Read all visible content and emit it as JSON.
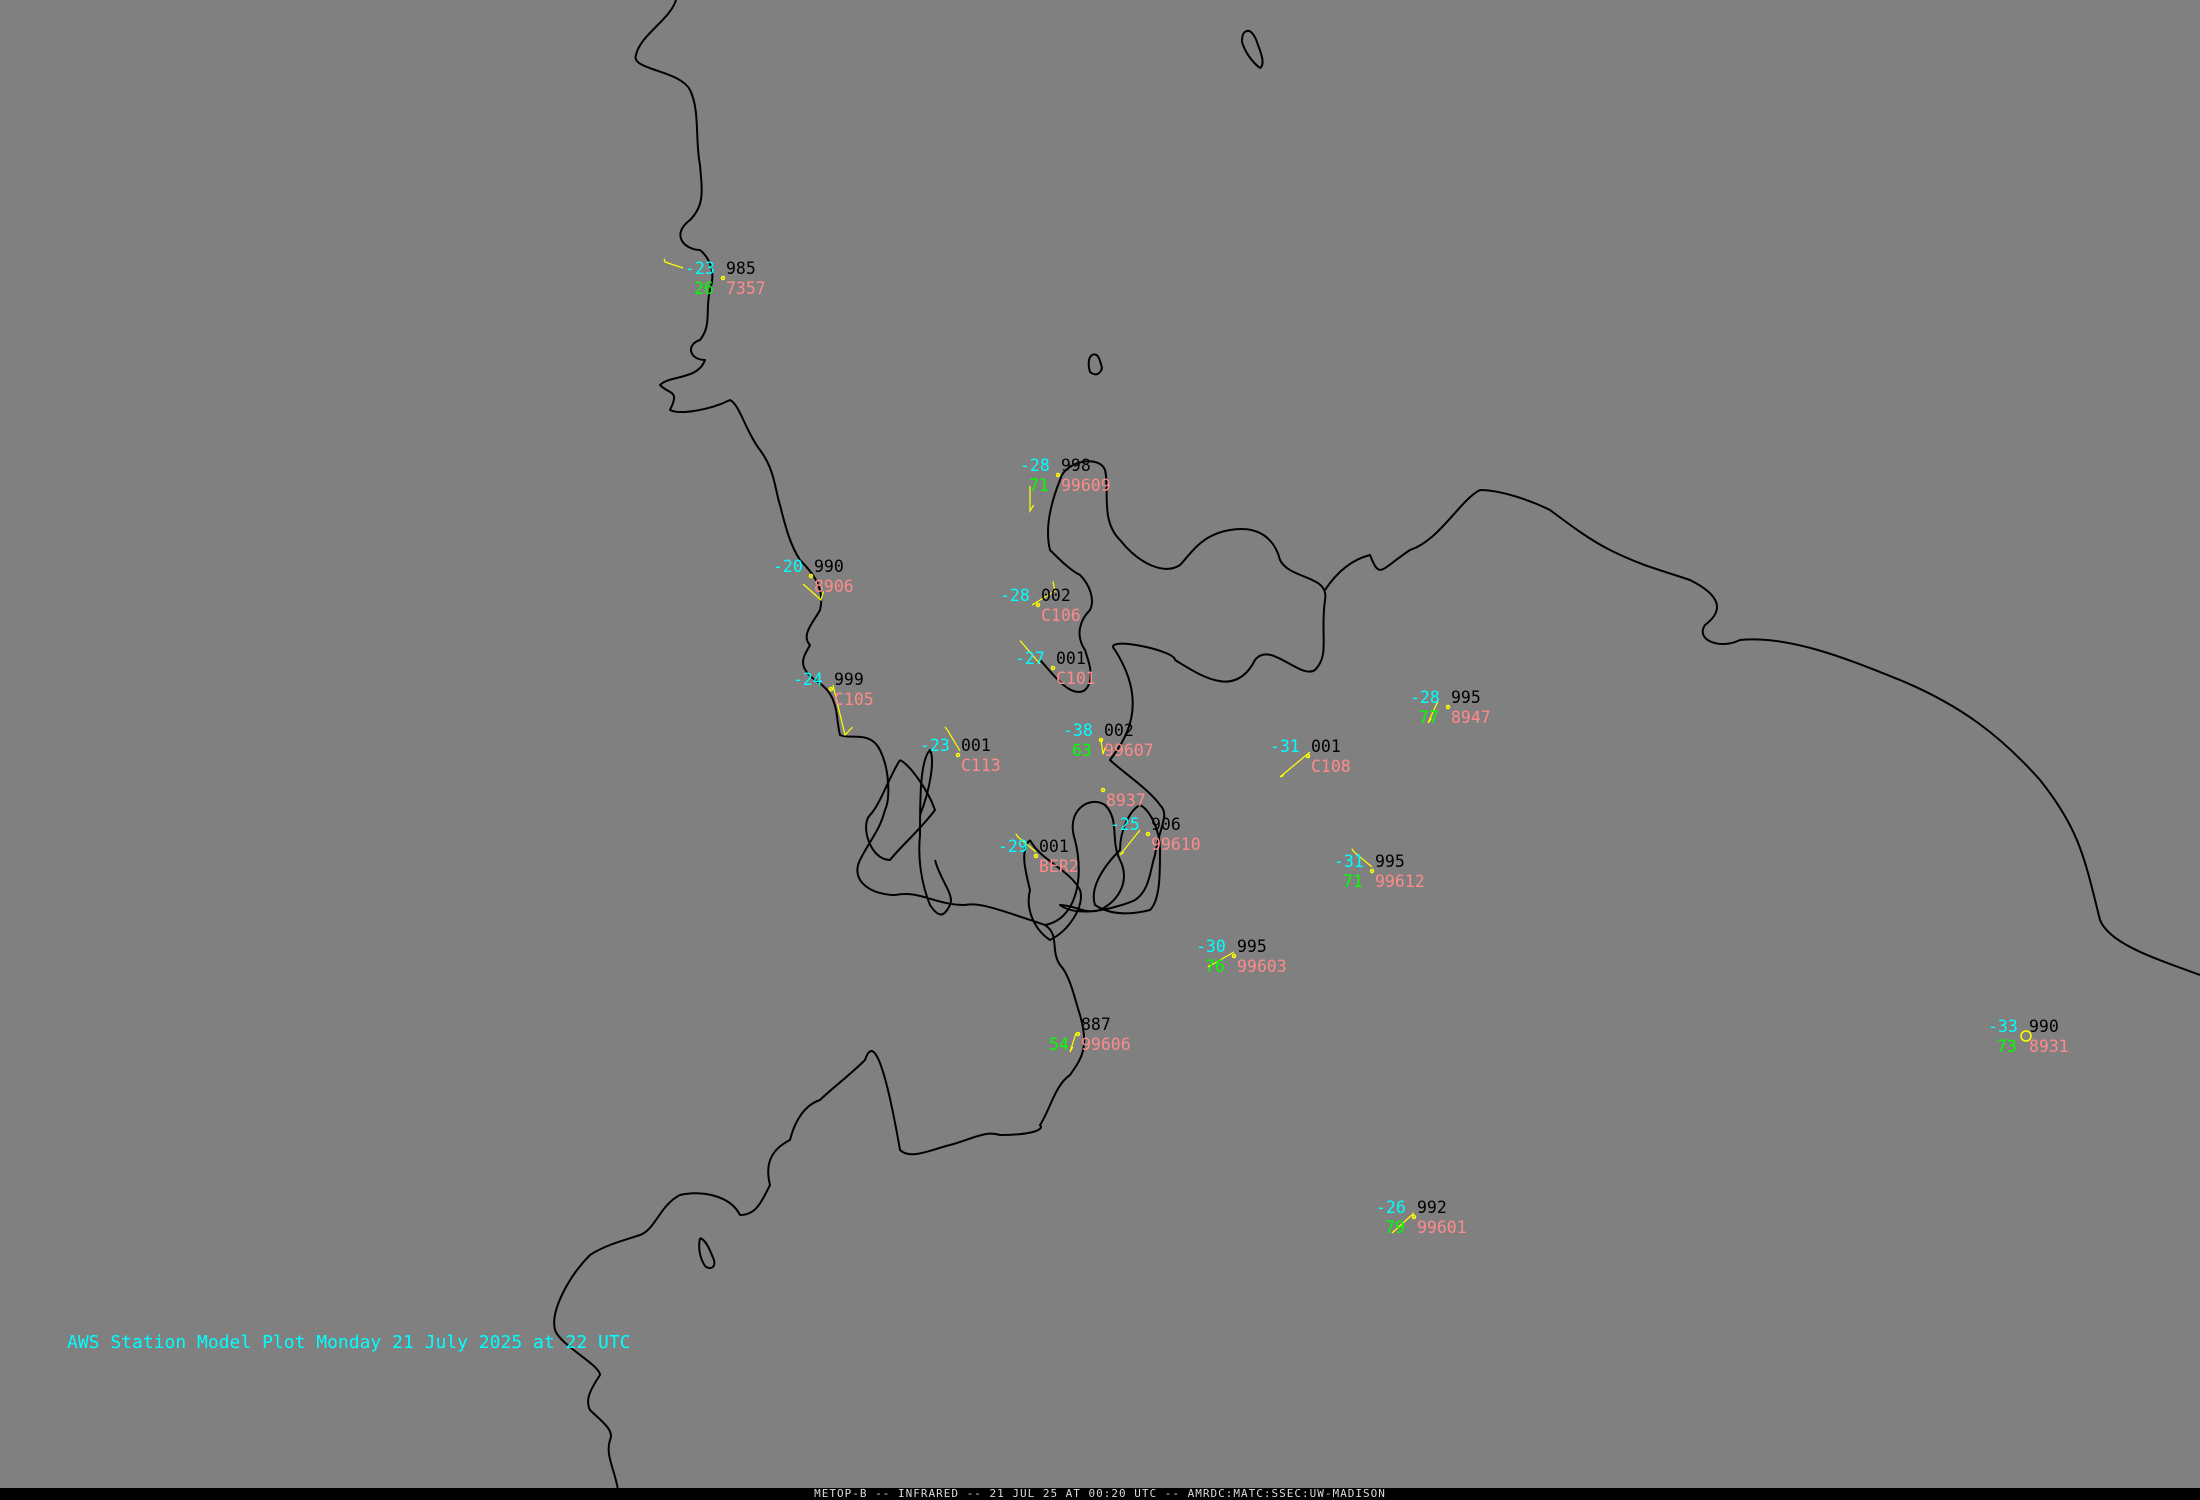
{
  "title": "AWS Station Model Plot Monday 21 July 2025 at 22 UTC",
  "footer": "METOP-B -- INFRARED -- 21 JUL 25 AT 00:20 UTC -- AMRDC:MATC:SSEC:UW-MADISON",
  "colors": {
    "background": "#808080",
    "coastline": "#000000",
    "temperature": "#00ffff",
    "pressure": "#000000",
    "humidity": "#00ff00",
    "station_id": "#ff8a8a",
    "wind_barb": "#ffff00",
    "title": "#00ffff",
    "footer_bg": "#000000",
    "footer_text": "#dcdcdc"
  },
  "stations": [
    {
      "temp": "-23",
      "pressure": "985",
      "rh": "26",
      "id": "7357"
    },
    {
      "temp": "-28",
      "pressure": "998",
      "rh": "71",
      "id": "99609"
    },
    {
      "temp": "-20",
      "pressure": "990",
      "rh": "",
      "id": "8906"
    },
    {
      "temp": "-28",
      "pressure": "002",
      "rh": "",
      "id": "C106"
    },
    {
      "temp": "-27",
      "pressure": "001",
      "rh": "",
      "id": "C101"
    },
    {
      "temp": "-24",
      "pressure": "999",
      "rh": "",
      "id": "C105"
    },
    {
      "temp": "-23",
      "pressure": "001",
      "rh": "",
      "id": "C113"
    },
    {
      "temp": "-38",
      "pressure": "002",
      "rh": "63",
      "id": "99607"
    },
    {
      "temp": "",
      "pressure": "",
      "rh": "",
      "id": "8937"
    },
    {
      "temp": "-28",
      "pressure": "995",
      "rh": "77",
      "id": "8947"
    },
    {
      "temp": "-31",
      "pressure": "001",
      "rh": "",
      "id": "C108"
    },
    {
      "temp": "-25",
      "pressure": "906",
      "rh": "",
      "id": "99610"
    },
    {
      "temp": "-29",
      "pressure": "001",
      "rh": "",
      "id": "BER2"
    },
    {
      "temp": "-31",
      "pressure": "995",
      "rh": "71",
      "id": "99612"
    },
    {
      "temp": "-30",
      "pressure": "995",
      "rh": "76",
      "id": "99603"
    },
    {
      "temp": "",
      "pressure": "887",
      "rh": "54",
      "id": "99606"
    },
    {
      "temp": "-33",
      "pressure": "990",
      "rh": "73",
      "id": "8931"
    },
    {
      "temp": "-26",
      "pressure": "992",
      "rh": "79",
      "id": "99601"
    }
  ]
}
